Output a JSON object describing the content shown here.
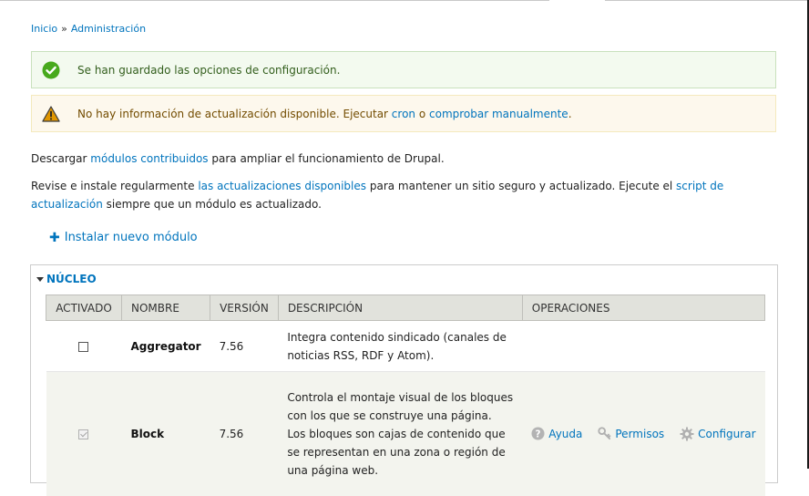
{
  "breadcrumb": {
    "home": "Inicio",
    "separator": "»",
    "admin": "Administración"
  },
  "messages": {
    "status": "Se han guardado las opciones de configuración.",
    "warning_prefix": "No hay información de actualización disponible. Ejecutar ",
    "warning_link1": "cron",
    "warning_mid": " o ",
    "warning_link2": "comprobar manualmente",
    "warning_suffix": "."
  },
  "intro": {
    "p1_prefix": "Descargar ",
    "p1_link": "módulos contribuidos",
    "p1_suffix": " para ampliar el funcionamiento de Drupal.",
    "p2_prefix": "Revise e instale regularmente ",
    "p2_link1": "las actualizaciones disponibles",
    "p2_mid": " para mantener un sitio seguro y actualizado. Ejecute el ",
    "p2_link2": "script de actualización",
    "p2_suffix": " siempre que un módulo es actualizado."
  },
  "install_link": "Instalar nuevo módulo",
  "fieldset_title": "NÚCLEO",
  "table": {
    "headers": [
      "ACTIVADO",
      "NOMBRE",
      "VERSIÓN",
      "DESCRIPCIÓN",
      "OPERACIONES"
    ],
    "rows": [
      {
        "enabled": false,
        "name": "Aggregator",
        "version": "7.56",
        "description": "Integra contenido sindicado (canales de noticias RSS, RDF y Atom).",
        "operations": []
      },
      {
        "enabled": true,
        "name": "Block",
        "version": "7.56",
        "description": "Controla el montaje visual de los bloques con los que se construye una página. Los bloques son cajas de contenido que se representan en una zona o región de una página web.",
        "operations": [
          "Ayuda",
          "Permisos",
          "Configurar"
        ]
      }
    ]
  },
  "colors": {
    "link": "#0074bd",
    "status_bg": "#f3faef",
    "warning_bg": "#fdf8ed",
    "header_bg": "#e1e2dc"
  },
  "icons": {
    "status": "check-circle-icon",
    "warning": "warning-triangle-icon",
    "help": "help-icon",
    "permissions": "key-icon",
    "configure": "gear-icon"
  }
}
